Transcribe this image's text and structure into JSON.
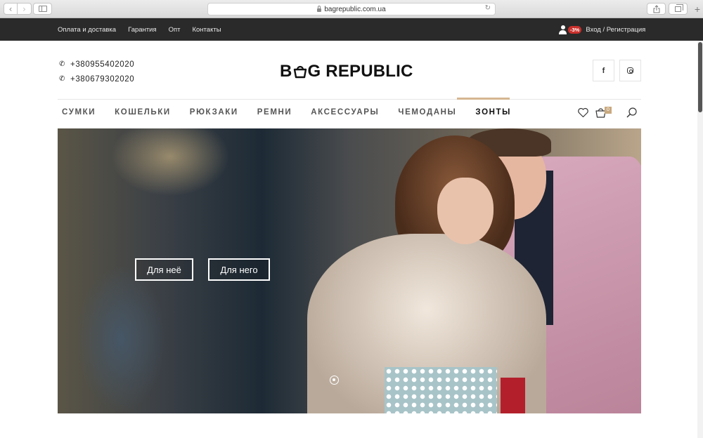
{
  "browser": {
    "url": "bagrepublic.com.ua",
    "newtab_label": "+"
  },
  "topbar": {
    "links": [
      "Оплата и доставка",
      "Гарантия",
      "Опт",
      "Контакты"
    ],
    "discount_badge": "-3%",
    "account_label": "Вход / Регистрация"
  },
  "header": {
    "phones": [
      "+380955402020",
      "+380679302020"
    ],
    "logo_left": "B",
    "logo_right": "G REPUBLIC",
    "facebook_label": "f"
  },
  "nav": {
    "items": [
      "СУМКИ",
      "КОШЕЛЬКИ",
      "РЮКЗАКИ",
      "РЕМНИ",
      "АКСЕССУАРЫ",
      "ЧЕМОДАНЫ",
      "ЗОНТЫ"
    ],
    "active_item": "ЗОНТЫ",
    "cart_count": "0",
    "accent_color": "#d6b690"
  },
  "hero": {
    "button_her": "Для неё",
    "button_him": "Для него"
  }
}
